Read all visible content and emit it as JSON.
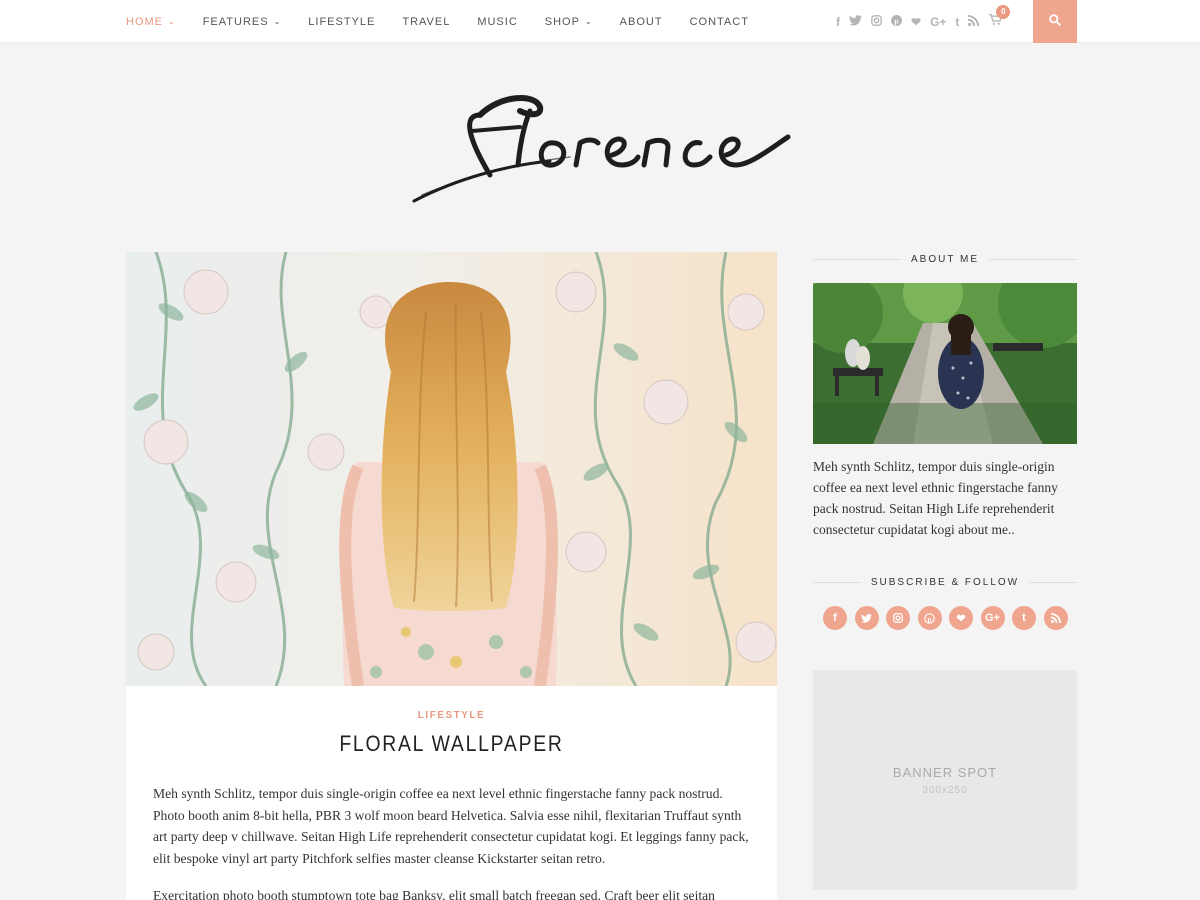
{
  "nav": {
    "items": [
      {
        "label": "HOME",
        "has_dropdown": true,
        "active": true
      },
      {
        "label": "FEATURES",
        "has_dropdown": true,
        "active": false
      },
      {
        "label": "LIFESTYLE",
        "has_dropdown": false,
        "active": false
      },
      {
        "label": "TRAVEL",
        "has_dropdown": false,
        "active": false
      },
      {
        "label": "MUSIC",
        "has_dropdown": false,
        "active": false
      },
      {
        "label": "SHOP",
        "has_dropdown": true,
        "active": false
      },
      {
        "label": "ABOUT",
        "has_dropdown": false,
        "active": false
      },
      {
        "label": "CONTACT",
        "has_dropdown": false,
        "active": false
      }
    ],
    "social_icons": [
      "facebook-icon",
      "twitter-icon",
      "instagram-icon",
      "pinterest-icon",
      "heart-icon",
      "google-plus-icon",
      "tumblr-icon",
      "rss-icon"
    ],
    "cart_count": "0"
  },
  "logo": {
    "text": "florence"
  },
  "post": {
    "category": "LIFESTYLE",
    "title": "FLORAL WALLPAPER",
    "excerpt_1": "Meh synth Schlitz, tempor duis single-origin coffee ea next level ethnic fingerstache fanny pack nostrud. Photo booth anim 8-bit hella, PBR 3 wolf moon beard Helvetica. Salvia esse nihil, flexitarian Truffaut synth art party deep v chillwave. Seitan High Life reprehenderit consectetur cupidatat kogi. Et leggings fanny pack, elit bespoke vinyl art party Pitchfork selfies master cleanse Kickstarter seitan retro.",
    "excerpt_2": "Exercitation photo booth stumptown tote bag Banksy, elit small batch freegan sed. Craft beer elit seitan"
  },
  "sidebar": {
    "about_title": "ABOUT ME",
    "about_text": "Meh synth Schlitz, tempor duis single-origin coffee ea next level ethnic fingerstache fanny pack nostrud. Seitan High Life reprehenderit consectetur cupidatat kogi about me..",
    "subscribe_title": "SUBSCRIBE & FOLLOW",
    "social_icons": [
      "facebook-icon",
      "twitter-icon",
      "instagram-icon",
      "pinterest-icon",
      "heart-icon",
      "google-plus-icon",
      "tumblr-icon",
      "rss-icon"
    ],
    "banner_label": "BANNER SPOT",
    "banner_size": "300x250"
  },
  "colors": {
    "accent": "#f0a58e",
    "accent_text": "#e8997f",
    "background": "#f4f4f4"
  }
}
